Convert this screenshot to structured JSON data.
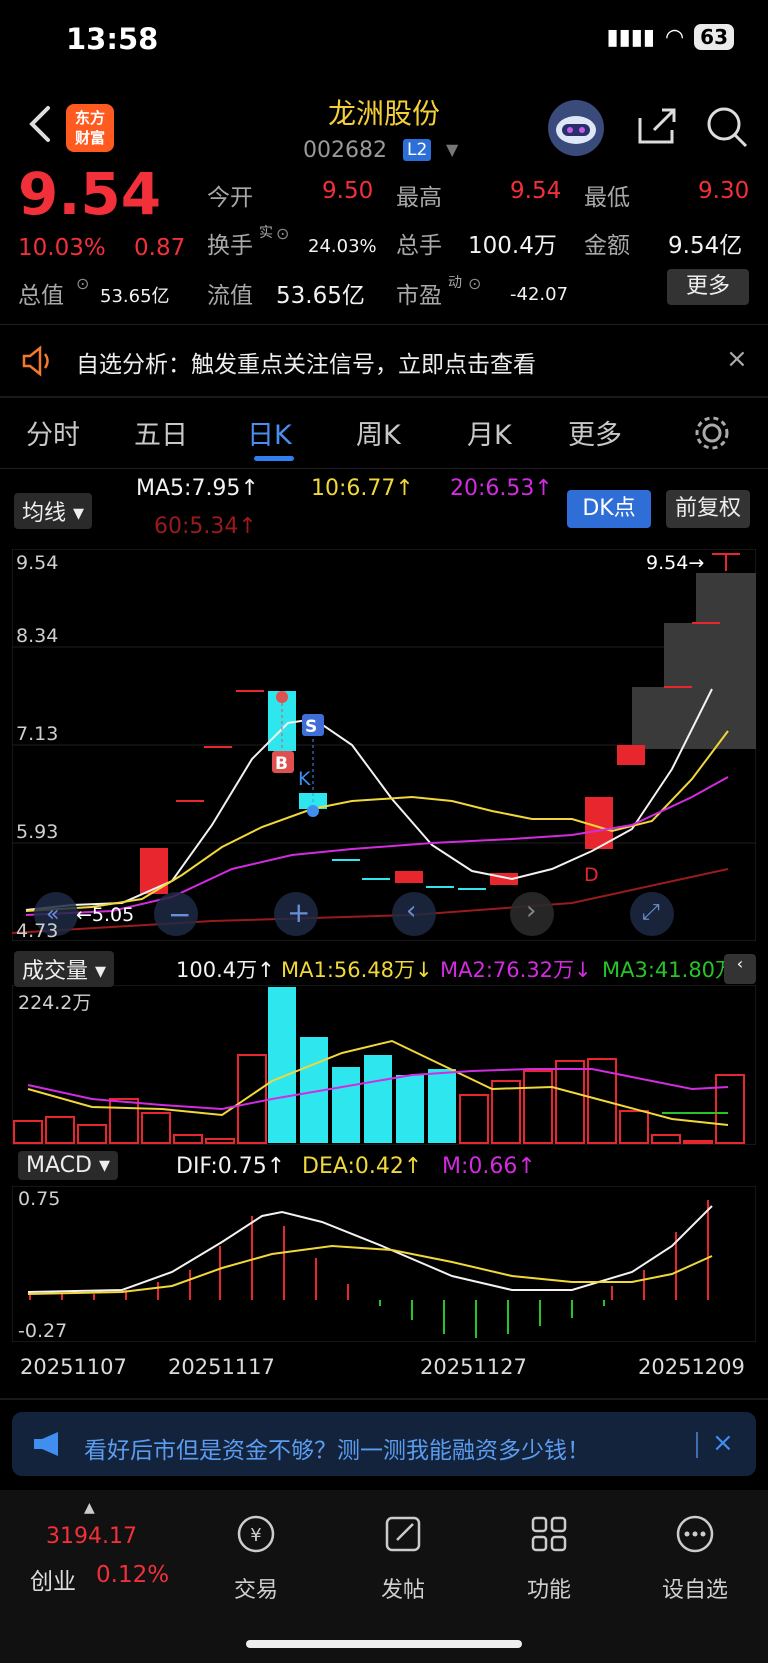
{
  "status": {
    "time": "13:58",
    "battery": "63"
  },
  "header": {
    "logo_text_1": "东方",
    "logo_text_2": "财富",
    "stock_name": "龙洲股份",
    "stock_code": "002682",
    "badge": "L2"
  },
  "quote": {
    "price": "9.54",
    "change_pct": "10.03%",
    "change": "0.87",
    "open_label": "今开",
    "open": "9.50",
    "high_label": "最高",
    "high": "9.54",
    "low_label": "最低",
    "low": "9.30",
    "turnover_label": "换手",
    "turnover_sup": "实",
    "turnover": "24.03%",
    "volume_label": "总手",
    "volume": "100.4万",
    "amount_label": "金额",
    "amount": "9.54亿",
    "mktcap_label": "总值",
    "mktcap": "53.65亿",
    "float_label": "流值",
    "float": "53.65亿",
    "pe_label": "市盈",
    "pe_sup": "动",
    "pe": "-42.07",
    "more": "更多"
  },
  "alert": {
    "text": "自选分析：触发重点关注信号，立即点击查看"
  },
  "tabs": [
    "分时",
    "五日",
    "日K",
    "周K",
    "月K",
    "更多"
  ],
  "kline": {
    "ma_selector": "均线",
    "ma5": "MA5:7.95",
    "ma10": "10:6.77",
    "ma20": "20:6.53",
    "ma60": "60:5.34",
    "dk_button": "DK点",
    "fq_button": "前复权",
    "y_labels": [
      "9.54",
      "8.34",
      "7.13",
      "5.93",
      "4.73"
    ],
    "last_price_marker": "9.54",
    "low_marker": "5.05",
    "signals": [
      "S",
      "K",
      "B",
      "D"
    ]
  },
  "volume": {
    "selector": "成交量",
    "value": "100.4万",
    "ma1": "MA1:56.48万",
    "ma2": "MA2:76.32万",
    "ma3": "MA3:41.80万",
    "y_label": "224.2万"
  },
  "macd": {
    "selector": "MACD",
    "dif": "DIF:0.75",
    "dea": "DEA:0.42",
    "m": "M:0.66",
    "y_top": "0.75",
    "y_bottom": "-0.27"
  },
  "dates": [
    "20251107",
    "20251117",
    "20251127",
    "20251209"
  ],
  "promo": {
    "text": "看好后市但是资金不够？测一测我能融资多少钱！"
  },
  "nav": {
    "index_value": "3194.17",
    "index_name": "创业",
    "index_pct": "0.12%",
    "trade": "交易",
    "post": "发帖",
    "func": "功能",
    "watch": "设自选"
  }
}
